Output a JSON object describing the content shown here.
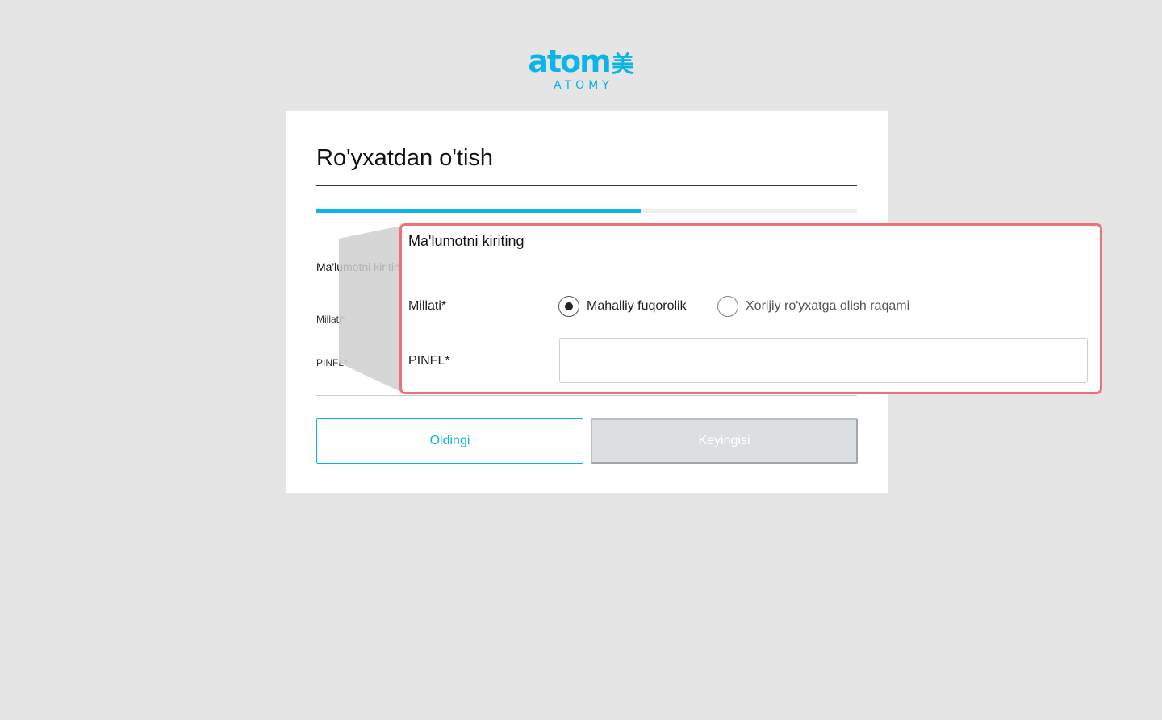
{
  "logo": {
    "mark": "atom",
    "mark_suffix": "美",
    "wordmark": "ATOMY"
  },
  "page": {
    "title": "Ro'yxatdan o'tish",
    "progress": 0.6
  },
  "form": {
    "section_title": "Ma'lumotni kiriting",
    "nationality_label": "Millati*",
    "nationality_options": [
      {
        "label": "Mahalliy fuqorolik",
        "selected": true
      },
      {
        "label": "Xorijiy ro'yxatga olish raqami",
        "selected": false
      }
    ],
    "pinfl_label": "PINFL*",
    "pinfl_value": ""
  },
  "buttons": {
    "prev_label": "Oldingi",
    "next_label": "Keyingisi",
    "next_disabled": true
  },
  "colors": {
    "accent": "#0ab4e6",
    "highlight_border": "#f07078",
    "disabled": "#dcdfe1",
    "background": "#e5e5e5"
  }
}
